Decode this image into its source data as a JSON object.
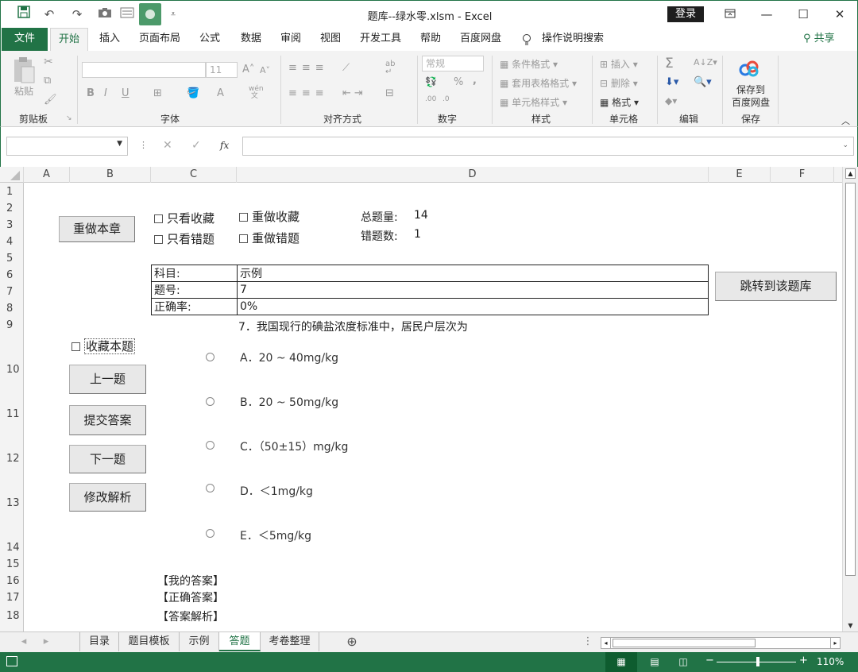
{
  "window": {
    "title": "题库--绿水零.xlsm  -  Excel",
    "login": "登录",
    "qat": [
      "save-icon",
      "undo-icon",
      "redo-icon",
      "camera-icon",
      "form-icon",
      "baidu-icon",
      "customize-icon"
    ]
  },
  "ribbon_tabs": [
    "文件",
    "开始",
    "插入",
    "页面布局",
    "公式",
    "数据",
    "审阅",
    "视图",
    "开发工具",
    "帮助",
    "百度网盘",
    "操作说明搜索"
  ],
  "share": "共享",
  "ribbon": {
    "clipboard": {
      "paste": "粘贴",
      "label": "剪贴板"
    },
    "font": {
      "size": "11",
      "label": "字体",
      "bold": "B",
      "italic": "I",
      "underline": "U",
      "wen": "wén\n文"
    },
    "alignment": {
      "label": "对齐方式"
    },
    "number": {
      "format": "常规",
      "label": "数字",
      "percent": "%",
      "comma": ","
    },
    "styles": {
      "cond": "条件格式",
      "table": "套用表格格式",
      "cell": "单元格样式",
      "label": "样式"
    },
    "cells": {
      "insert": "插入",
      "delete": "删除",
      "format": "格式",
      "label": "单元格"
    },
    "editing": {
      "label": "编辑",
      "sigma": "Σ"
    },
    "save": {
      "line1": "保存到",
      "line2": "百度网盘",
      "label": "保存"
    }
  },
  "formula": {
    "fx": "fx"
  },
  "columns": [
    "A",
    "B",
    "C",
    "D",
    "E",
    "F"
  ],
  "rows": [
    "1",
    "2",
    "3",
    "4",
    "5",
    "6",
    "7",
    "8",
    "9",
    "10",
    "11",
    "12",
    "13",
    "14",
    "15",
    "16",
    "17",
    "18"
  ],
  "sheet": {
    "redo_chapter": "重做本章",
    "only_fav": "只看收藏",
    "redo_fav": "重做收藏",
    "only_wrong": "只看错题",
    "redo_wrong": "重做错题",
    "total_label": "总题量:",
    "total_value": "14",
    "wrong_label": "错题数:",
    "wrong_value": "1",
    "info": [
      {
        "k": "科目:",
        "v": "示例"
      },
      {
        "k": "题号:",
        "v": "7"
      },
      {
        "k": "正确率:",
        "v": "0%"
      }
    ],
    "jump": "跳转到该题库",
    "question": "7．我国现行的碘盐浓度标准中，居民户层次为",
    "fav_this": "收藏本题",
    "prev": "上一题",
    "submit": "提交答案",
    "next": "下一题",
    "edit": "修改解析",
    "options": [
      "A．20 ~ 40mg/kg",
      "B．20 ~ 50mg/kg",
      "C．（50±15）mg/kg",
      "D．＜1mg/kg",
      "E．＜5mg/kg"
    ],
    "my_answer": "【我的答案】",
    "correct_answer": "【正确答案】",
    "analysis": "【答案解析】"
  },
  "sheet_tabs": [
    "目录",
    "题目模板",
    "示例",
    "答题",
    "考卷整理"
  ],
  "active_sheet": "答题",
  "status": {
    "zoom": "110%"
  }
}
